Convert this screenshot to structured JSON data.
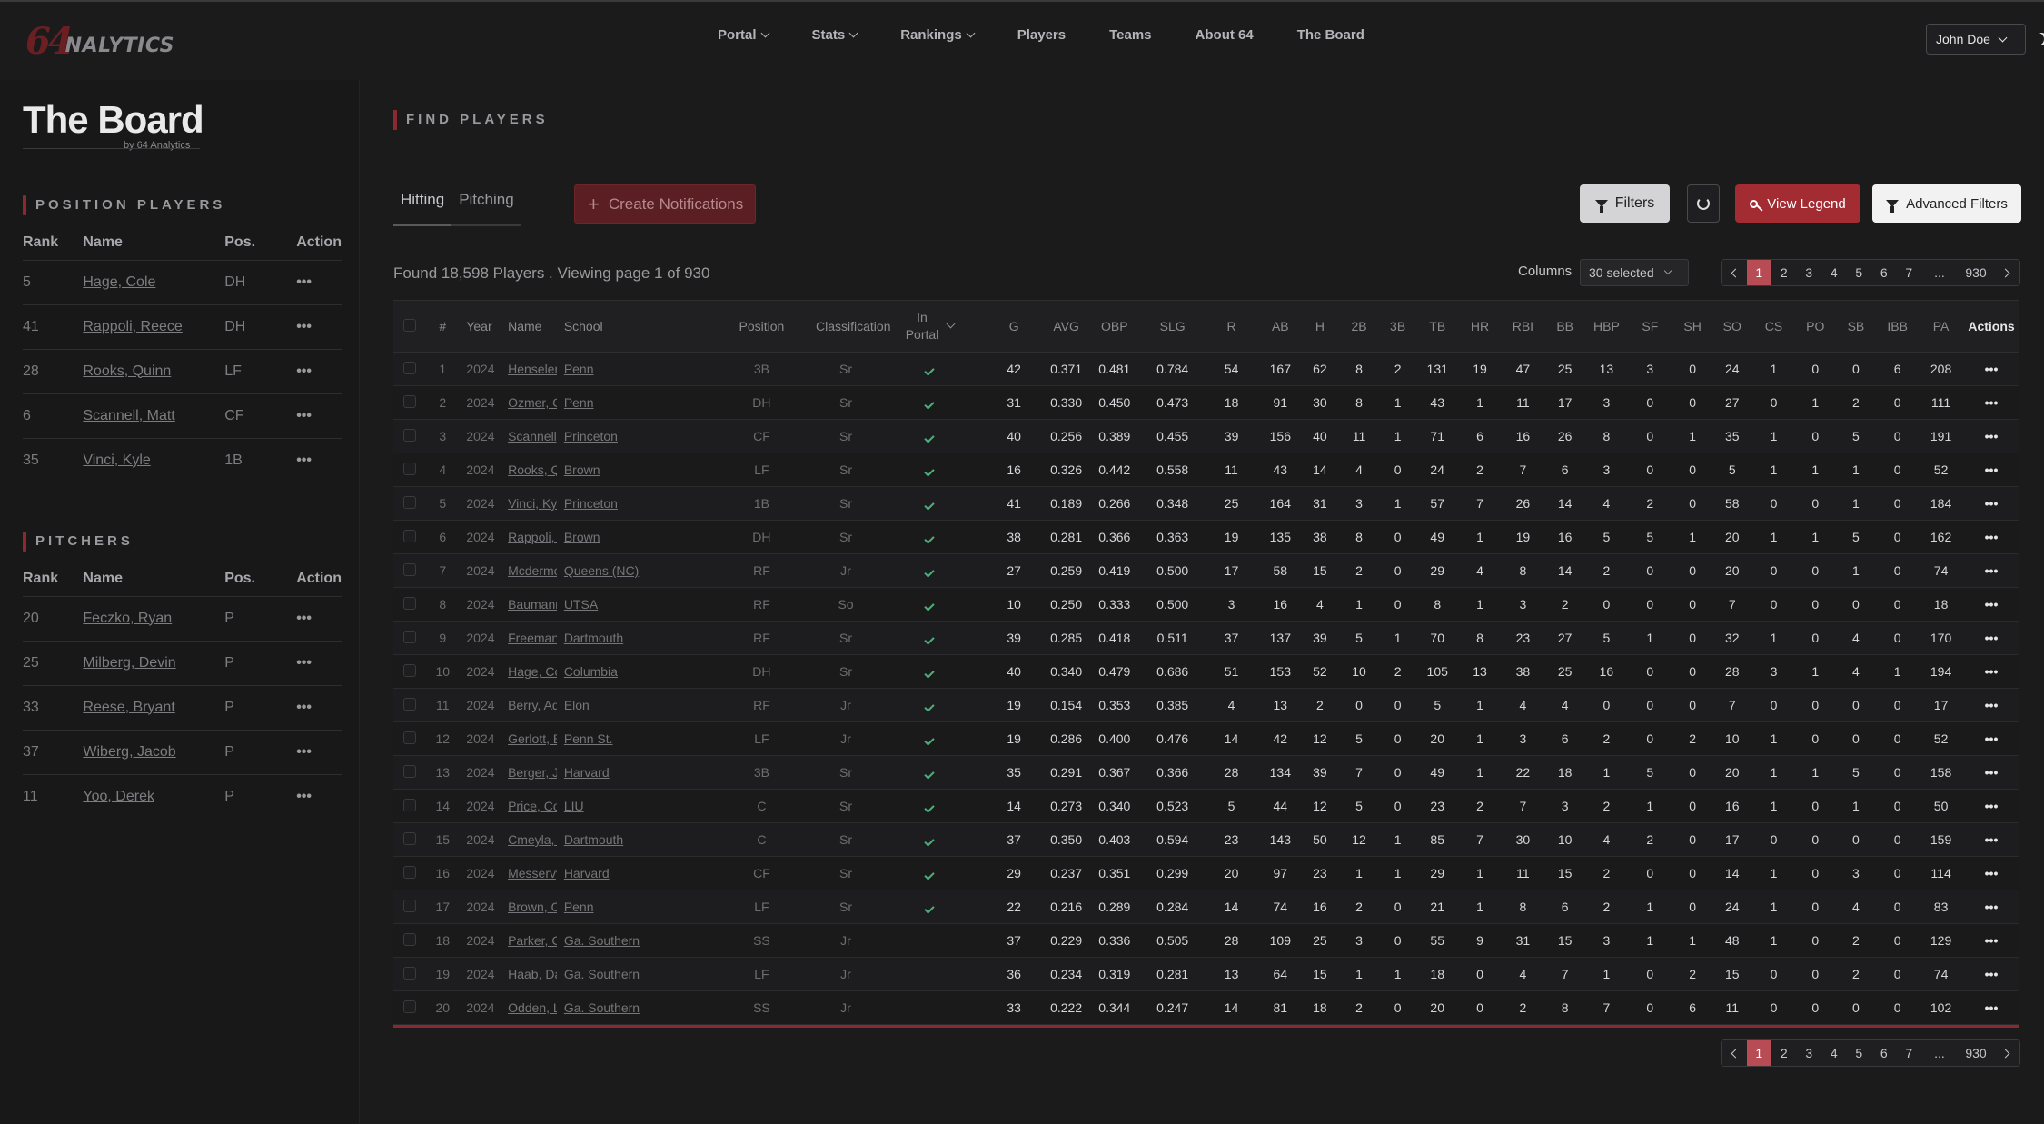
{
  "header": {
    "logo_num": "64",
    "logo_text": "NALYTICS",
    "nav": [
      {
        "label": "Portal",
        "dropdown": true
      },
      {
        "label": "Stats",
        "dropdown": true
      },
      {
        "label": "Rankings",
        "dropdown": true
      },
      {
        "label": "Players",
        "dropdown": false
      },
      {
        "label": "Teams",
        "dropdown": false
      },
      {
        "label": "About 64",
        "dropdown": false
      },
      {
        "label": "The Board",
        "dropdown": false
      }
    ],
    "user": "John Doe"
  },
  "sidebar": {
    "title": "The Board",
    "subtitle": "by 64 Analytics",
    "position_players": {
      "title": "POSITION PLAYERS",
      "columns": [
        "Rank",
        "Name",
        "Pos.",
        "Action"
      ],
      "rows": [
        {
          "rank": "5",
          "name": "Hage, Cole",
          "pos": "DH"
        },
        {
          "rank": "41",
          "name": "Rappoli, Reece",
          "pos": "DH"
        },
        {
          "rank": "28",
          "name": "Rooks, Quinn",
          "pos": "LF"
        },
        {
          "rank": "6",
          "name": "Scannell, Matt",
          "pos": "CF"
        },
        {
          "rank": "35",
          "name": "Vinci, Kyle",
          "pos": "1B"
        }
      ]
    },
    "pitchers": {
      "title": "PITCHERS",
      "columns": [
        "Rank",
        "Name",
        "Pos.",
        "Action"
      ],
      "rows": [
        {
          "rank": "20",
          "name": "Feczko, Ryan",
          "pos": "P"
        },
        {
          "rank": "25",
          "name": "Milberg, Devin",
          "pos": "P"
        },
        {
          "rank": "33",
          "name": "Reese, Bryant",
          "pos": "P"
        },
        {
          "rank": "37",
          "name": "Wiberg, Jacob",
          "pos": "P"
        },
        {
          "rank": "11",
          "name": "Yoo, Derek",
          "pos": "P"
        }
      ]
    }
  },
  "main": {
    "title": "FIND PLAYERS",
    "tabs": [
      "Hitting",
      "Pitching"
    ],
    "create_notifications": "Create Notifications",
    "filters": "Filters",
    "view_legend": "View Legend",
    "advanced_filters": "Advanced Filters",
    "found_text": "Found 18,598 Players . Viewing page 1 of 930",
    "columns_label": "Columns",
    "columns_value": "30 selected",
    "pagination": [
      "1",
      "2",
      "3",
      "4",
      "5",
      "6",
      "7",
      "...",
      "930"
    ],
    "current_page": "1",
    "table": {
      "headers": [
        "#",
        "Year",
        "Name",
        "School",
        "Position",
        "Classification",
        "In Portal",
        "G",
        "AVG",
        "OBP",
        "SLG",
        "R",
        "AB",
        "H",
        "2B",
        "3B",
        "TB",
        "HR",
        "RBI",
        "BB",
        "HBP",
        "SF",
        "SH",
        "SO",
        "CS",
        "PO",
        "SB",
        "IBB",
        "PA",
        "Actions"
      ],
      "rows": [
        [
          "1",
          "2024",
          "Henseler, Wyatt",
          "Penn",
          "3B",
          "Sr",
          true,
          "42",
          "0.371",
          "0.481",
          "0.784",
          "54",
          "167",
          "62",
          "8",
          "2",
          "131",
          "19",
          "47",
          "25",
          "13",
          "3",
          "0",
          "24",
          "1",
          "0",
          "0",
          "6",
          "208"
        ],
        [
          "2",
          "2024",
          "Ozmer, Carson",
          "Penn",
          "DH",
          "Sr",
          true,
          "31",
          "0.330",
          "0.450",
          "0.473",
          "18",
          "91",
          "30",
          "8",
          "1",
          "43",
          "1",
          "11",
          "17",
          "3",
          "0",
          "0",
          "27",
          "0",
          "1",
          "2",
          "0",
          "111"
        ],
        [
          "3",
          "2024",
          "Scannell, Matt",
          "Princeton",
          "CF",
          "Sr",
          true,
          "40",
          "0.256",
          "0.389",
          "0.455",
          "39",
          "156",
          "40",
          "11",
          "1",
          "71",
          "6",
          "16",
          "26",
          "8",
          "0",
          "1",
          "35",
          "1",
          "0",
          "5",
          "0",
          "191"
        ],
        [
          "4",
          "2024",
          "Rooks, Quinn",
          "Brown",
          "LF",
          "Sr",
          true,
          "16",
          "0.326",
          "0.442",
          "0.558",
          "11",
          "43",
          "14",
          "4",
          "0",
          "24",
          "2",
          "7",
          "6",
          "3",
          "0",
          "0",
          "5",
          "1",
          "1",
          "1",
          "0",
          "52"
        ],
        [
          "5",
          "2024",
          "Vinci, Kyle",
          "Princeton",
          "1B",
          "Sr",
          true,
          "41",
          "0.189",
          "0.266",
          "0.348",
          "25",
          "164",
          "31",
          "3",
          "1",
          "57",
          "7",
          "26",
          "14",
          "4",
          "2",
          "0",
          "58",
          "0",
          "0",
          "1",
          "0",
          "184"
        ],
        [
          "6",
          "2024",
          "Rappoli, Reece",
          "Brown",
          "DH",
          "Sr",
          true,
          "38",
          "0.281",
          "0.366",
          "0.363",
          "19",
          "135",
          "38",
          "8",
          "0",
          "49",
          "1",
          "19",
          "16",
          "5",
          "5",
          "1",
          "20",
          "1",
          "1",
          "5",
          "0",
          "162"
        ],
        [
          "7",
          "2024",
          "Mcdermott, Andrew",
          "Queens (NC)",
          "RF",
          "Jr",
          true,
          "27",
          "0.259",
          "0.419",
          "0.500",
          "17",
          "58",
          "15",
          "2",
          "0",
          "29",
          "4",
          "8",
          "14",
          "2",
          "0",
          "0",
          "20",
          "0",
          "0",
          "1",
          "0",
          "74"
        ],
        [
          "8",
          "2024",
          "Baumann, Aiden",
          "UTSA",
          "RF",
          "So",
          true,
          "10",
          "0.250",
          "0.333",
          "0.500",
          "3",
          "16",
          "4",
          "1",
          "0",
          "8",
          "1",
          "3",
          "2",
          "0",
          "0",
          "0",
          "7",
          "0",
          "0",
          "0",
          "0",
          "18"
        ],
        [
          "9",
          "2024",
          "Freeman, Kolton",
          "Dartmouth",
          "RF",
          "Sr",
          true,
          "39",
          "0.285",
          "0.418",
          "0.511",
          "37",
          "137",
          "39",
          "5",
          "1",
          "70",
          "8",
          "23",
          "27",
          "5",
          "1",
          "0",
          "32",
          "1",
          "0",
          "4",
          "0",
          "170"
        ],
        [
          "10",
          "2024",
          "Hage, Cole",
          "Columbia",
          "DH",
          "Sr",
          true,
          "40",
          "0.340",
          "0.479",
          "0.686",
          "51",
          "153",
          "52",
          "10",
          "2",
          "105",
          "13",
          "38",
          "25",
          "16",
          "0",
          "0",
          "28",
          "3",
          "1",
          "4",
          "1",
          "194"
        ],
        [
          "11",
          "2024",
          "Berry, Adam",
          "Elon",
          "RF",
          "Jr",
          true,
          "19",
          "0.154",
          "0.353",
          "0.385",
          "4",
          "13",
          "2",
          "0",
          "0",
          "5",
          "1",
          "4",
          "4",
          "0",
          "0",
          "0",
          "7",
          "0",
          "0",
          "0",
          "0",
          "17"
        ],
        [
          "12",
          "2024",
          "Gerlott, Billy",
          "Penn St.",
          "LF",
          "Jr",
          true,
          "19",
          "0.286",
          "0.400",
          "0.476",
          "14",
          "42",
          "12",
          "5",
          "0",
          "20",
          "1",
          "3",
          "6",
          "2",
          "0",
          "2",
          "10",
          "1",
          "0",
          "0",
          "0",
          "52"
        ],
        [
          "13",
          "2024",
          "Berger, Jake",
          "Harvard",
          "3B",
          "Sr",
          true,
          "35",
          "0.291",
          "0.367",
          "0.366",
          "28",
          "134",
          "39",
          "7",
          "0",
          "49",
          "1",
          "22",
          "18",
          "1",
          "5",
          "0",
          "20",
          "1",
          "1",
          "5",
          "0",
          "158"
        ],
        [
          "14",
          "2024",
          "Price, Connor",
          "LIU",
          "C",
          "Sr",
          true,
          "14",
          "0.273",
          "0.340",
          "0.523",
          "5",
          "44",
          "12",
          "5",
          "0",
          "23",
          "2",
          "7",
          "3",
          "2",
          "1",
          "0",
          "16",
          "1",
          "0",
          "1",
          "0",
          "50"
        ],
        [
          "15",
          "2024",
          "Cmeyla, Nathan",
          "Dartmouth",
          "C",
          "Sr",
          true,
          "37",
          "0.350",
          "0.403",
          "0.594",
          "23",
          "143",
          "50",
          "12",
          "1",
          "85",
          "7",
          "30",
          "10",
          "4",
          "2",
          "0",
          "17",
          "0",
          "0",
          "0",
          "0",
          "159"
        ],
        [
          "16",
          "2024",
          "Messervy, Peter",
          "Harvard",
          "CF",
          "Sr",
          true,
          "29",
          "0.237",
          "0.351",
          "0.299",
          "20",
          "97",
          "23",
          "1",
          "1",
          "29",
          "1",
          "11",
          "15",
          "2",
          "0",
          "0",
          "14",
          "1",
          "0",
          "3",
          "0",
          "114"
        ],
        [
          "17",
          "2024",
          "Brown, Calvin",
          "Penn",
          "LF",
          "Sr",
          true,
          "22",
          "0.216",
          "0.289",
          "0.284",
          "14",
          "74",
          "16",
          "2",
          "0",
          "21",
          "1",
          "8",
          "6",
          "2",
          "1",
          "0",
          "24",
          "1",
          "0",
          "4",
          "0",
          "83"
        ],
        [
          "18",
          "2024",
          "Parker, Cade",
          "Ga. Southern",
          "SS",
          "Jr",
          false,
          "37",
          "0.229",
          "0.336",
          "0.505",
          "28",
          "109",
          "25",
          "3",
          "0",
          "55",
          "9",
          "31",
          "15",
          "3",
          "1",
          "1",
          "48",
          "1",
          "0",
          "2",
          "0",
          "129"
        ],
        [
          "19",
          "2024",
          "Haab, Daniel",
          "Ga. Southern",
          "LF",
          "Jr",
          false,
          "36",
          "0.234",
          "0.319",
          "0.281",
          "13",
          "64",
          "15",
          "1",
          "1",
          "18",
          "0",
          "4",
          "7",
          "1",
          "0",
          "2",
          "15",
          "0",
          "0",
          "2",
          "0",
          "74"
        ],
        [
          "20",
          "2024",
          "Odden, Luke",
          "Ga. Southern",
          "SS",
          "Jr",
          false,
          "33",
          "0.222",
          "0.344",
          "0.247",
          "14",
          "81",
          "18",
          "2",
          "0",
          "20",
          "0",
          "2",
          "8",
          "7",
          "0",
          "6",
          "11",
          "0",
          "0",
          "0",
          "0",
          "102"
        ]
      ]
    }
  }
}
